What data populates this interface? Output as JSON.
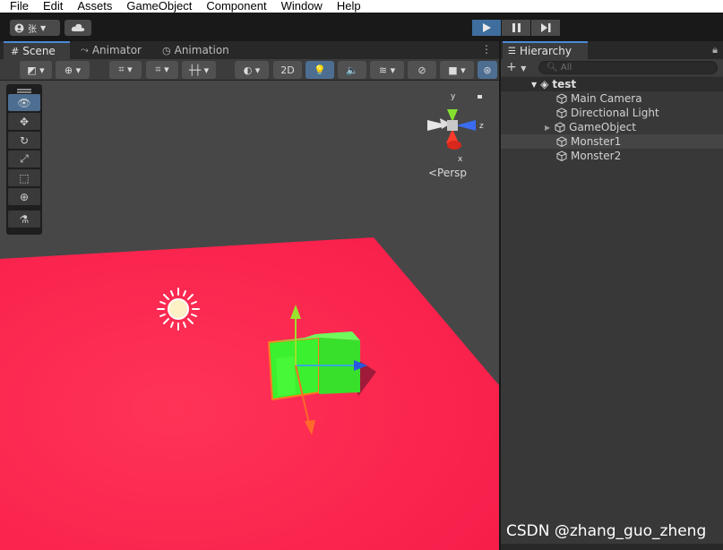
{
  "menu": [
    "File",
    "Edit",
    "Assets",
    "GameObject",
    "Component",
    "Window",
    "Help"
  ],
  "toolbar": {
    "account_label": "张",
    "play_icon": "play-icon",
    "pause_icon": "pause-icon",
    "step_icon": "step-icon"
  },
  "scene_tabs": [
    {
      "label": "Scene",
      "icon": "grid-icon"
    },
    {
      "label": "Animator",
      "icon": "animator-icon"
    },
    {
      "label": "Animation",
      "icon": "clock-icon"
    }
  ],
  "scene_toolbar": {
    "mode_2d": "2D"
  },
  "viewport": {
    "persp_label": "<Persp",
    "axis_labels": {
      "y": "y",
      "z": "z",
      "x": "x"
    },
    "colors": {
      "background": "#474747",
      "plane": "#fd2150",
      "cube": "#3ef032",
      "selection_outline": "#ff7a1f"
    }
  },
  "hierarchy": {
    "tab_label": "Hierarchy",
    "search_placeholder": "All",
    "scene_name": "test",
    "items": [
      {
        "label": "Main Camera",
        "expandable": false,
        "selected": false
      },
      {
        "label": "Directional Light",
        "expandable": false,
        "selected": false
      },
      {
        "label": "GameObject",
        "expandable": true,
        "selected": false
      },
      {
        "label": "Monster1",
        "expandable": false,
        "selected": true
      },
      {
        "label": "Monster2",
        "expandable": false,
        "selected": false
      }
    ]
  },
  "watermark": "CSDN @zhang_guo_zheng"
}
